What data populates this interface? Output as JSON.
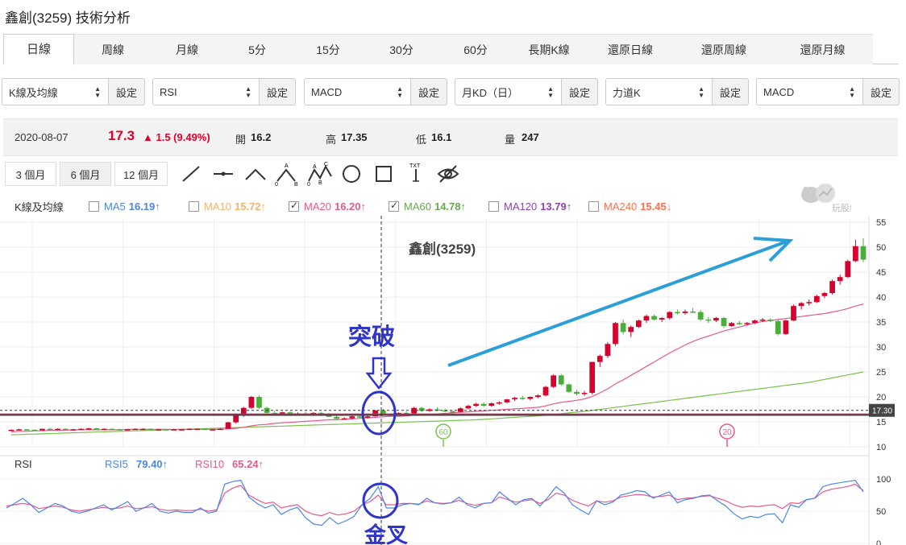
{
  "page_title": "鑫創(3259) 技術分析",
  "tabs": [
    {
      "label": "日線",
      "active": true
    },
    {
      "label": "周線"
    },
    {
      "label": "月線"
    },
    {
      "label": "5分"
    },
    {
      "label": "15分"
    },
    {
      "label": "30分"
    },
    {
      "label": "60分"
    },
    {
      "label": "長期K線"
    },
    {
      "label": "還原日線"
    },
    {
      "label": "還原周線"
    },
    {
      "label": "還原月線"
    }
  ],
  "selectors": [
    {
      "value": "K線及均線",
      "button": "設定"
    },
    {
      "value": "RSI",
      "button": "設定"
    },
    {
      "value": "MACD",
      "button": "設定"
    },
    {
      "value": "月KD（日）",
      "button": "設定"
    },
    {
      "value": "力道K",
      "button": "設定"
    },
    {
      "value": "MACD",
      "button": "設定"
    }
  ],
  "quote": {
    "date": "2020-08-07",
    "price": "17.3",
    "change": "▲ 1.5 (9.49%)",
    "open_label": "開",
    "open": "16.2",
    "high_label": "高",
    "high": "17.35",
    "low_label": "低",
    "low": "16.1",
    "volume_label": "量",
    "volume": "247"
  },
  "ranges": [
    "3 個月",
    "6 個月",
    "12 個月"
  ],
  "active_range": "6 個月",
  "tools": [
    "line-tool-icon",
    "horizontal-line-icon",
    "angle-icon",
    "abc-pattern-icon",
    "abcd-pattern-icon",
    "circle-tool-icon",
    "rectangle-tool-icon",
    "text-tool-icon",
    "hide-drawings-icon"
  ],
  "tool_labels": {
    "abc": [
      "A",
      "0",
      "B"
    ],
    "abcd": [
      "A",
      "C",
      "0",
      "B"
    ],
    "txt": "TXT"
  },
  "legend": {
    "title": "K線及均線",
    "items": [
      {
        "name": "MA5",
        "value": "16.19↑",
        "color": "#4a86e8",
        "checked": false
      },
      {
        "name": "MA10",
        "value": "15.72↑",
        "color": "#f6b26b",
        "checked": false
      },
      {
        "name": "MA20",
        "value": "16.20↑",
        "color": "#e8588b",
        "checked": true
      },
      {
        "name": "MA60",
        "value": "14.78↑",
        "color": "#6aa84f",
        "checked": true
      },
      {
        "name": "MA120",
        "value": "13.79↑",
        "color": "#8e44ad",
        "checked": false
      },
      {
        "name": "MA240",
        "value": "15.45↓",
        "color": "#ff6f4f",
        "checked": false
      }
    ]
  },
  "watermark": "玩股網",
  "chart_title": "鑫創(3259)",
  "price_axis": [
    "55",
    "50",
    "45",
    "40",
    "35",
    "30",
    "25",
    "20",
    "15",
    "10"
  ],
  "price_tag": "17.30",
  "ma_markers": [
    "60",
    "20"
  ],
  "annotations": {
    "breakout": "突破",
    "golden_cross": "金叉"
  },
  "rsi": {
    "title": "RSI",
    "rsi5_label": "RSI5",
    "rsi5_value": "79.40↑",
    "rsi10_label": "RSI10",
    "rsi10_value": "65.24↑",
    "axis": [
      "100",
      "50",
      "0"
    ]
  },
  "colors": {
    "up": "#d8002c",
    "down": "#4cae3a",
    "ma20": "#e8588b",
    "ma60": "#7cc04e",
    "rsi5": "#4a86e8",
    "rsi10": "#e8588b",
    "annotation": "#2f35c9",
    "arrow": "#2a9fd8"
  },
  "chart_data": {
    "type": "candlestick",
    "title": "鑫創(3259)",
    "ylim": [
      10,
      55
    ],
    "candles": [
      [
        13.3,
        13.5,
        13.2,
        13.4
      ],
      [
        13.4,
        13.6,
        13.3,
        13.5
      ],
      [
        13.5,
        13.6,
        13.3,
        13.4
      ],
      [
        13.4,
        13.5,
        13.2,
        13.3
      ],
      [
        13.3,
        13.6,
        13.3,
        13.6
      ],
      [
        13.6,
        13.8,
        13.5,
        13.5
      ],
      [
        13.5,
        13.7,
        13.4,
        13.6
      ],
      [
        13.6,
        13.7,
        13.4,
        13.5
      ],
      [
        13.5,
        13.6,
        13.4,
        13.5
      ],
      [
        13.5,
        13.7,
        13.4,
        13.6
      ],
      [
        13.6,
        13.8,
        13.5,
        13.7
      ],
      [
        13.7,
        13.8,
        13.5,
        13.6
      ],
      [
        13.6,
        13.7,
        13.5,
        13.6
      ],
      [
        13.6,
        13.7,
        13.4,
        13.5
      ],
      [
        13.5,
        13.6,
        13.3,
        13.4
      ],
      [
        13.4,
        13.6,
        13.3,
        13.5
      ],
      [
        13.5,
        13.7,
        13.4,
        13.6
      ],
      [
        13.6,
        13.7,
        13.5,
        13.6
      ],
      [
        13.6,
        13.7,
        13.4,
        13.5
      ],
      [
        13.5,
        13.6,
        13.4,
        13.5
      ],
      [
        13.5,
        13.6,
        13.3,
        13.4
      ],
      [
        13.4,
        13.6,
        13.3,
        13.5
      ],
      [
        13.5,
        13.6,
        13.4,
        13.5
      ],
      [
        13.5,
        13.7,
        13.4,
        13.6
      ],
      [
        13.6,
        13.7,
        13.5,
        13.6
      ],
      [
        13.6,
        13.7,
        13.4,
        13.5
      ],
      [
        13.5,
        13.6,
        13.4,
        13.5
      ],
      [
        13.5,
        13.8,
        13.4,
        13.6
      ],
      [
        13.6,
        15.0,
        13.6,
        14.9
      ],
      [
        14.9,
        16.5,
        14.7,
        16.3
      ],
      [
        16.3,
        18.0,
        16.0,
        17.8
      ],
      [
        17.8,
        20.2,
        17.6,
        20.0
      ],
      [
        20.0,
        20.3,
        17.6,
        17.8
      ],
      [
        17.8,
        18.0,
        16.6,
        16.8
      ],
      [
        16.8,
        17.2,
        16.3,
        16.6
      ],
      [
        16.6,
        17.0,
        16.3,
        16.9
      ],
      [
        16.9,
        17.1,
        16.4,
        16.6
      ],
      [
        16.6,
        16.9,
        16.2,
        16.7
      ],
      [
        16.7,
        17.0,
        16.4,
        16.5
      ],
      [
        16.5,
        16.9,
        16.3,
        16.8
      ],
      [
        16.8,
        17.0,
        16.3,
        16.5
      ],
      [
        16.5,
        16.8,
        15.9,
        16.0
      ],
      [
        16.0,
        16.2,
        15.5,
        15.6
      ],
      [
        15.6,
        15.9,
        15.4,
        15.7
      ],
      [
        15.7,
        16.2,
        15.5,
        16.1
      ],
      [
        16.1,
        16.4,
        15.8,
        15.9
      ],
      [
        15.9,
        16.2,
        15.6,
        16.1
      ],
      [
        16.1,
        17.35,
        16.1,
        17.3
      ],
      [
        17.3,
        17.6,
        16.2,
        16.4
      ],
      [
        16.4,
        16.7,
        16.2,
        16.5
      ],
      [
        16.5,
        16.9,
        16.3,
        16.8
      ],
      [
        16.8,
        17.1,
        16.5,
        16.7
      ],
      [
        16.7,
        18.0,
        16.6,
        17.8
      ],
      [
        17.8,
        18.0,
        17.0,
        17.2
      ],
      [
        17.2,
        17.7,
        17.0,
        17.5
      ],
      [
        17.5,
        17.9,
        17.1,
        17.3
      ],
      [
        17.3,
        17.6,
        17.0,
        17.1
      ],
      [
        17.1,
        17.3,
        16.8,
        17.0
      ],
      [
        17.0,
        17.9,
        16.9,
        17.7
      ],
      [
        17.7,
        18.4,
        17.5,
        18.2
      ],
      [
        18.2,
        18.8,
        18.0,
        18.6
      ],
      [
        18.6,
        18.9,
        18.0,
        18.2
      ],
      [
        18.2,
        18.9,
        18.0,
        18.7
      ],
      [
        18.7,
        19.1,
        18.4,
        18.9
      ],
      [
        18.9,
        19.6,
        18.7,
        19.5
      ],
      [
        19.5,
        20.0,
        19.2,
        19.8
      ],
      [
        19.8,
        20.2,
        19.4,
        19.6
      ],
      [
        19.6,
        20.1,
        19.3,
        20.0
      ],
      [
        20.0,
        20.5,
        19.7,
        20.3
      ],
      [
        20.3,
        22.2,
        20.1,
        22.0
      ],
      [
        22.0,
        24.5,
        21.8,
        24.3
      ],
      [
        24.3,
        24.6,
        22.2,
        22.5
      ],
      [
        22.5,
        22.7,
        20.8,
        21.0
      ],
      [
        21.0,
        21.4,
        20.3,
        20.6
      ],
      [
        20.6,
        21.2,
        20.2,
        20.8
      ],
      [
        20.8,
        27.0,
        20.5,
        27.0
      ],
      [
        27.0,
        28.5,
        26.0,
        28.2
      ],
      [
        28.2,
        31.0,
        27.8,
        30.6
      ],
      [
        30.6,
        35.0,
        30.2,
        34.8
      ],
      [
        34.8,
        35.5,
        32.5,
        33.0
      ],
      [
        33.0,
        34.3,
        32.0,
        34.0
      ],
      [
        34.0,
        35.5,
        33.8,
        35.3
      ],
      [
        35.3,
        36.5,
        34.8,
        36.2
      ],
      [
        36.2,
        36.5,
        35.3,
        35.5
      ],
      [
        35.5,
        36.0,
        35.0,
        35.8
      ],
      [
        35.8,
        37.2,
        35.5,
        37.0
      ],
      [
        37.0,
        37.5,
        36.5,
        36.8
      ],
      [
        36.8,
        37.5,
        36.5,
        37.1
      ],
      [
        37.1,
        37.8,
        36.8,
        37.0
      ],
      [
        37.0,
        37.4,
        35.2,
        35.5
      ],
      [
        35.5,
        36.0,
        34.8,
        35.3
      ],
      [
        35.3,
        36.0,
        35.0,
        35.8
      ],
      [
        35.8,
        36.0,
        33.8,
        34.2
      ],
      [
        34.2,
        35.0,
        34.0,
        34.8
      ],
      [
        34.8,
        35.2,
        34.4,
        34.6
      ],
      [
        34.6,
        35.0,
        34.3,
        34.8
      ],
      [
        34.8,
        35.5,
        34.6,
        35.3
      ],
      [
        35.3,
        35.8,
        35.0,
        35.5
      ],
      [
        35.5,
        35.7,
        35.0,
        35.2
      ],
      [
        35.2,
        35.4,
        32.3,
        32.6
      ],
      [
        32.6,
        35.5,
        32.4,
        35.3
      ],
      [
        35.3,
        38.5,
        35.2,
        38.2
      ],
      [
        38.2,
        39.0,
        37.5,
        38.8
      ],
      [
        38.8,
        39.5,
        38.3,
        39.0
      ],
      [
        39.0,
        40.5,
        38.8,
        40.2
      ],
      [
        40.2,
        41.0,
        39.8,
        40.8
      ],
      [
        40.8,
        43.5,
        40.5,
        43.2
      ],
      [
        43.2,
        44.5,
        42.5,
        44.0
      ],
      [
        44.0,
        47.5,
        43.8,
        47.2
      ],
      [
        47.2,
        51.5,
        47.0,
        50.2
      ],
      [
        50.2,
        51.8,
        47.0,
        47.5
      ]
    ],
    "ma20": [
      13.0,
      13.1,
      13.1,
      13.2,
      13.2,
      13.3,
      13.3,
      13.3,
      13.4,
      13.4,
      13.4,
      13.4,
      13.4,
      13.4,
      13.4,
      13.5,
      13.5,
      13.5,
      13.5,
      13.5,
      13.5,
      13.5,
      13.5,
      13.5,
      13.5,
      13.5,
      13.5,
      13.5,
      13.6,
      13.7,
      13.9,
      14.2,
      14.4,
      14.5,
      14.7,
      14.8,
      14.9,
      15.0,
      15.1,
      15.2,
      15.3,
      15.4,
      15.4,
      15.5,
      15.6,
      15.7,
      15.8,
      15.9,
      16.0,
      16.1,
      16.1,
      16.2,
      16.3,
      16.4,
      16.5,
      16.6,
      16.7,
      16.8,
      16.9,
      17.0,
      17.1,
      17.2,
      17.3,
      17.4,
      17.5,
      17.6,
      17.7,
      17.8,
      17.9,
      18.2,
      18.6,
      18.9,
      19.1,
      19.3,
      19.6,
      20.1,
      20.8,
      21.6,
      22.6,
      23.4,
      24.3,
      25.2,
      26.1,
      27.0,
      27.9,
      28.8,
      29.6,
      30.4,
      31.1,
      31.7,
      32.2,
      32.7,
      33.2,
      33.6,
      34.0,
      34.4,
      34.8,
      35.1,
      35.3,
      35.5,
      35.7,
      35.9,
      36.1,
      36.3,
      36.5,
      36.7,
      37.0,
      37.3,
      37.7,
      38.2,
      38.6
    ],
    "ma60": [
      12.4,
      12.45,
      12.5,
      12.55,
      12.6,
      12.65,
      12.7,
      12.75,
      12.8,
      12.85,
      12.9,
      12.95,
      13.0,
      13.05,
      13.1,
      13.15,
      13.2,
      13.25,
      13.3,
      13.35,
      13.4,
      13.45,
      13.5,
      13.55,
      13.6,
      13.65,
      13.7,
      13.75,
      13.8,
      13.85,
      13.9,
      13.95,
      14.0,
      14.05,
      14.1,
      14.15,
      14.2,
      14.25,
      14.3,
      14.35,
      14.4,
      14.45,
      14.5,
      14.55,
      14.6,
      14.65,
      14.7,
      14.75,
      14.8,
      14.85,
      14.9,
      14.95,
      15.0,
      15.05,
      15.1,
      15.15,
      15.2,
      15.25,
      15.3,
      15.35,
      15.4,
      15.5,
      15.6,
      15.7,
      15.8,
      15.9,
      16.0,
      16.1,
      16.2,
      16.35,
      16.5,
      16.65,
      16.8,
      16.95,
      17.1,
      17.3,
      17.5,
      17.7,
      17.9,
      18.1,
      18.3,
      18.5,
      18.7,
      18.9,
      19.1,
      19.3,
      19.5,
      19.7,
      19.9,
      20.1,
      20.3,
      20.5,
      20.7,
      20.9,
      21.1,
      21.3,
      21.5,
      21.7,
      21.9,
      22.1,
      22.3,
      22.5,
      22.7,
      22.9,
      23.2,
      23.5,
      23.8,
      24.1,
      24.4,
      24.7,
      25.0
    ]
  },
  "rsi_data": {
    "rsi5": [
      55,
      62,
      70,
      60,
      48,
      55,
      62,
      58,
      50,
      47,
      50,
      55,
      60,
      52,
      58,
      65,
      50,
      55,
      62,
      50,
      47,
      50,
      48,
      48,
      55,
      47,
      50,
      92,
      96,
      98,
      72,
      62,
      55,
      60,
      45,
      52,
      56,
      40,
      30,
      28,
      40,
      30,
      35,
      42,
      60,
      70,
      88,
      55,
      55,
      60,
      62,
      60,
      70,
      63,
      61,
      63,
      72,
      60,
      55,
      62,
      63,
      80,
      70,
      60,
      68,
      70,
      58,
      72,
      88,
      78,
      60,
      52,
      45,
      66,
      60,
      64,
      75,
      78,
      82,
      80,
      70,
      75,
      80,
      63,
      68,
      70,
      74,
      75,
      66,
      58,
      46,
      38,
      42,
      40,
      45,
      46,
      32,
      60,
      56,
      68,
      70,
      88,
      92,
      94,
      96,
      98,
      80
    ],
    "rsi10": [
      58,
      60,
      62,
      60,
      54,
      56,
      58,
      56,
      52,
      50,
      52,
      54,
      56,
      54,
      55,
      58,
      54,
      55,
      57,
      53,
      51,
      52,
      51,
      51,
      53,
      50,
      52,
      78,
      86,
      90,
      75,
      68,
      62,
      64,
      55,
      58,
      60,
      50,
      45,
      43,
      48,
      44,
      46,
      50,
      60,
      65,
      75,
      60,
      60,
      62,
      62,
      61,
      66,
      63,
      62,
      63,
      67,
      62,
      59,
      62,
      63,
      72,
      68,
      64,
      66,
      68,
      62,
      68,
      78,
      75,
      67,
      62,
      58,
      66,
      64,
      66,
      72,
      74,
      76,
      75,
      72,
      73,
      75,
      68,
      70,
      71,
      73,
      74,
      70,
      66,
      60,
      56,
      58,
      57,
      59,
      60,
      54,
      63,
      62,
      68,
      70,
      80,
      84,
      86,
      88,
      92,
      82
    ]
  }
}
